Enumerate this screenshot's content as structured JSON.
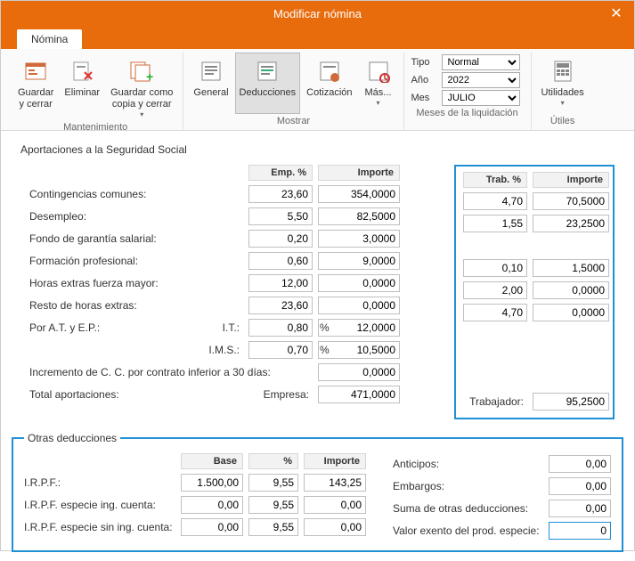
{
  "window": {
    "title": "Modificar nómina"
  },
  "tabs": {
    "nomina": "Nómina"
  },
  "ribbon": {
    "mantenimiento": {
      "label": "Mantenimiento",
      "guardar": "Guardar\ny cerrar",
      "eliminar": "Eliminar",
      "guardarcomo": "Guardar como\ncopia y cerrar"
    },
    "mostrar": {
      "label": "Mostrar",
      "general": "General",
      "deducciones": "Deducciones",
      "cotizacion": "Cotización",
      "mas": "Más..."
    },
    "liquidacion": {
      "label": "Meses de la liquidación",
      "tipo_label": "Tipo",
      "tipo_value": "Normal",
      "ano_label": "Año",
      "ano_value": "2022",
      "mes_label": "Mes",
      "mes_value": "JULIO"
    },
    "utiles": {
      "label": "Útiles",
      "utilidades": "Utilidades"
    }
  },
  "aportaciones": {
    "title": "Aportaciones a la Seguridad Social",
    "hdr_emp_pct": "Emp. %",
    "hdr_importe": "Importe",
    "hdr_trab_pct": "Trab. %",
    "rows": {
      "contingencias": {
        "label": "Contingencias comunes:",
        "emp_pct": "23,60",
        "importe": "354,0000",
        "trab_pct": "4,70",
        "trab_imp": "70,5000"
      },
      "desempleo": {
        "label": "Desempleo:",
        "emp_pct": "5,50",
        "importe": "82,5000",
        "trab_pct": "1,55",
        "trab_imp": "23,2500"
      },
      "fgs": {
        "label": "Fondo de garantía salarial:",
        "emp_pct": "0,20",
        "importe": "3,0000"
      },
      "formacion": {
        "label": "Formación profesional:",
        "emp_pct": "0,60",
        "importe": "9,0000",
        "trab_pct": "0,10",
        "trab_imp": "1,5000"
      },
      "hefm": {
        "label": "Horas extras fuerza mayor:",
        "emp_pct": "12,00",
        "importe": "0,0000",
        "trab_pct": "2,00",
        "trab_imp": "0,0000"
      },
      "resto": {
        "label": "Resto de horas extras:",
        "emp_pct": "23,60",
        "importe": "0,0000",
        "trab_pct": "4,70",
        "trab_imp": "0,0000"
      },
      "at": {
        "label": "Por A.T. y E.P.:",
        "it_label": "I.T.:",
        "it_pct": "0,80",
        "it_imp": "12,0000",
        "ims_label": "I.M.S.:",
        "ims_pct": "0,70",
        "ims_imp": "10,5000"
      },
      "incremento": {
        "label": "Incremento de C. C. por contrato inferior a 30 días:",
        "importe": "0,0000"
      },
      "total": {
        "label": "Total aportaciones:",
        "empresa_label": "Empresa:",
        "empresa_val": "471,0000",
        "trab_label": "Trabajador:",
        "trab_val": "95,2500"
      }
    }
  },
  "otras": {
    "title": "Otras deducciones",
    "hdr_base": "Base",
    "hdr_pct": "%",
    "hdr_importe": "Importe",
    "irpf": {
      "label": "I.R.P.F.:",
      "base": "1.500,00",
      "pct": "9,55",
      "importe": "143,25"
    },
    "esp_ing": {
      "label": "I.R.P.F. especie ing. cuenta:",
      "base": "0,00",
      "pct": "9,55",
      "importe": "0,00"
    },
    "esp_sin": {
      "label": "I.R.P.F. especie sin ing. cuenta:",
      "base": "0,00",
      "pct": "9,55",
      "importe": "0,00"
    },
    "anticipos": {
      "label": "Anticipos:",
      "value": "0,00"
    },
    "embargos": {
      "label": "Embargos:",
      "value": "0,00"
    },
    "suma": {
      "label": "Suma de otras deducciones:",
      "value": "0,00"
    },
    "valor_exento": {
      "label": "Valor exento del prod. especie:",
      "value": "0"
    }
  }
}
